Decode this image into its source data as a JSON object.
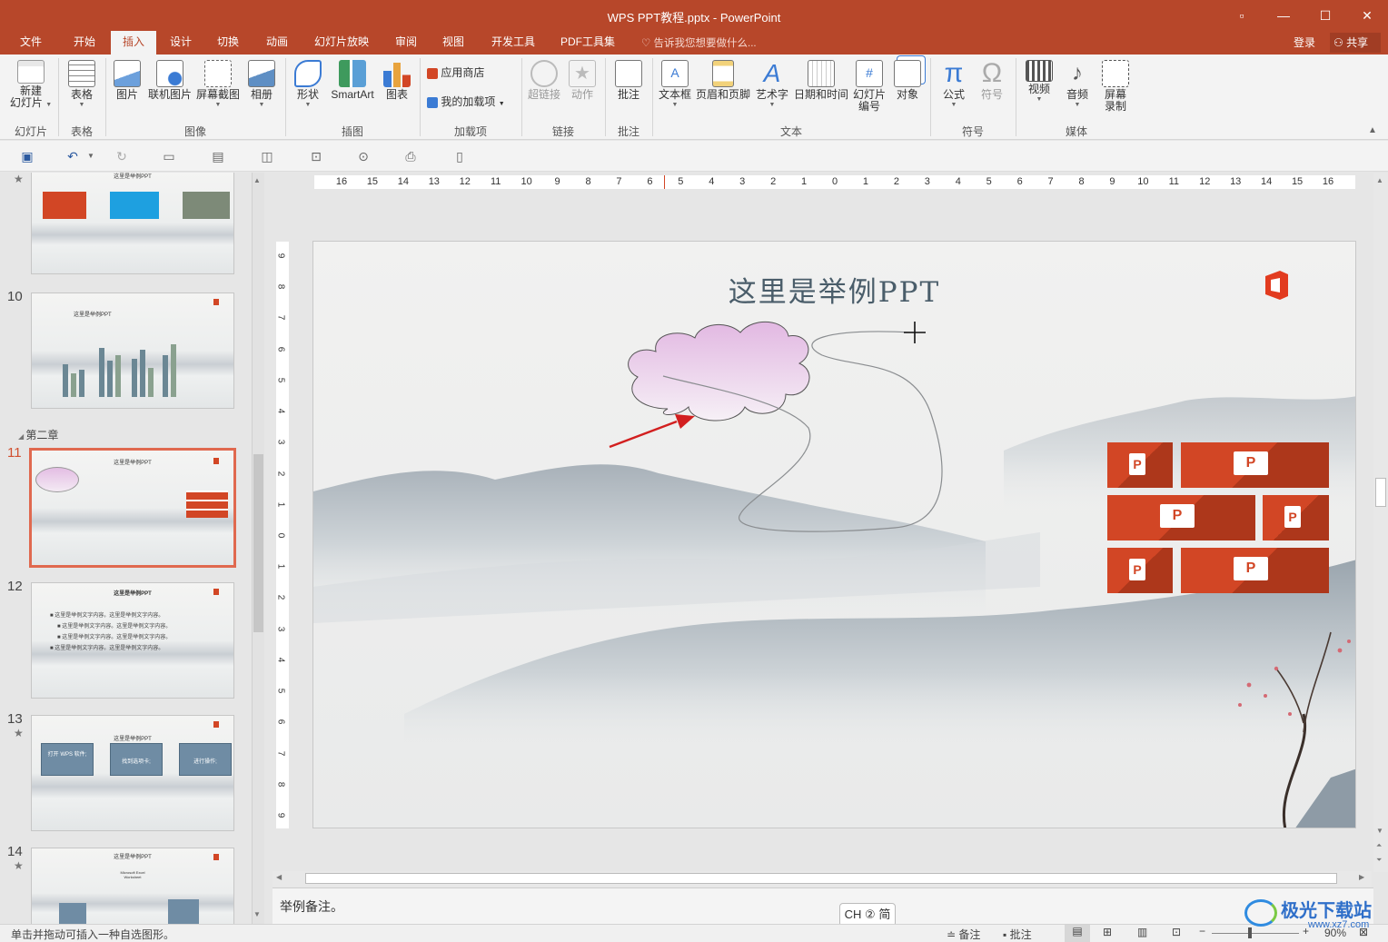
{
  "window": {
    "title": "WPS PPT教程.pptx - PowerPoint",
    "restore": "▫",
    "minimize": "—",
    "maximize": "☐",
    "close": "✕"
  },
  "tabs": [
    "文件",
    "开始",
    "插入",
    "设计",
    "切换",
    "动画",
    "幻灯片放映",
    "审阅",
    "视图",
    "开发工具",
    "PDF工具集"
  ],
  "active_tab": "插入",
  "tell_me": "告诉我您想要做什么...",
  "login": "登录",
  "share": "共享",
  "ribbon": {
    "new_slide_1": "新建",
    "new_slide_2": "幻灯片",
    "table": "表格",
    "picture": "图片",
    "online_picture": "联机图片",
    "screenshot": "屏幕截图",
    "album": "相册",
    "shapes": "形状",
    "smartart": "SmartArt",
    "chart": "图表",
    "store": "应用商店",
    "my_addins": "我的加载项",
    "hyperlink": "超链接",
    "action": "动作",
    "comment": "批注",
    "textbox": "文本框",
    "header_footer": "页眉和页脚",
    "wordart": "艺术字",
    "datetime": "日期和时间",
    "slide_number_1": "幻灯片",
    "slide_number_2": "编号",
    "object": "对象",
    "equation": "公式",
    "symbol": "符号",
    "video": "视频",
    "audio": "音频",
    "screen_rec_1": "屏幕",
    "screen_rec_2": "录制",
    "groups": [
      "幻灯片",
      "表格",
      "图像",
      "插图",
      "加载项",
      "链接",
      "批注",
      "文本",
      "符号",
      "媒体"
    ]
  },
  "thumbnails": {
    "t10_num": "10",
    "t11_num": "11",
    "t12_num": "12",
    "t13_num": "13",
    "t14_num": "14",
    "section": "第二章",
    "t_title": "这里是举例PPT",
    "t12_title": "这里是举例PPT",
    "t12_lines": [
      "这里是举例文字内容。这里是举例文字内容。",
      "这里是举例文字内容。这里是举例文字内容。",
      "这里是举例文字内容。这里是举例文字内容。",
      "这里是举例文字内容。这里是举例文字内容。"
    ],
    "t13_boxes": [
      "打开 WPS 软件;",
      "找到选项卡;",
      "进行操作;"
    ],
    "t14_caption": "Microsoft Excel Worksheet"
  },
  "slide": {
    "title": "这里是举例PPT"
  },
  "ruler_h": [
    "16",
    "15",
    "14",
    "13",
    "12",
    "11",
    "10",
    "9",
    "8",
    "7",
    "6",
    "5",
    "4",
    "3",
    "2",
    "1",
    "0",
    "1",
    "2",
    "3",
    "4",
    "5",
    "6",
    "7",
    "8",
    "9",
    "10",
    "11",
    "12",
    "13",
    "14",
    "15",
    "16"
  ],
  "ruler_v": [
    "9",
    "8",
    "7",
    "6",
    "5",
    "4",
    "3",
    "2",
    "1",
    "0",
    "1",
    "2",
    "3",
    "4",
    "5",
    "6",
    "7",
    "8",
    "9"
  ],
  "notes": "举例备注。",
  "ime": "CH ② 简",
  "status": {
    "hint": "单击并拖动可插入一种自选图形。",
    "notes_btn": "备注",
    "comments_btn": "批注",
    "zoom": "90%"
  },
  "watermark": {
    "name": "极光下载站",
    "url": "www.xz7.com"
  }
}
